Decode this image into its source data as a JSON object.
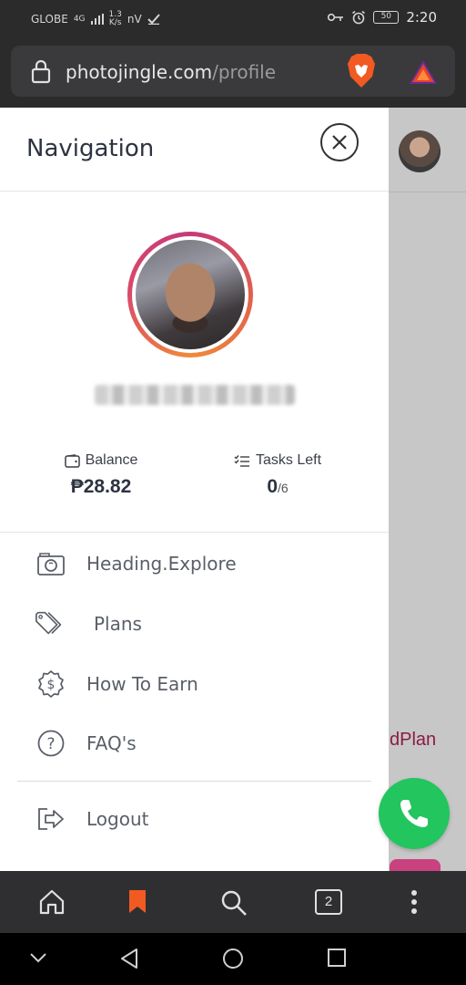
{
  "status_bar": {
    "carrier": "GLOBE",
    "network": "4G",
    "speed": "1.3",
    "speed_unit": "K/s",
    "extra": "nV",
    "battery": "50",
    "time": "2:20"
  },
  "browser": {
    "url_domain": "photojingle.com",
    "url_path": "/profile",
    "tab_count": "2"
  },
  "drawer": {
    "title": "Navigation",
    "balance_label": "Balance",
    "balance_value": "₱28.82",
    "tasks_label": "Tasks Left",
    "tasks_done": "0",
    "tasks_total": "/6",
    "menu": [
      {
        "label": "Heading.Explore",
        "icon": "camera-icon"
      },
      {
        "label": "Plans",
        "icon": "tags-icon"
      },
      {
        "label": "How To Earn",
        "icon": "dollar-badge-icon"
      },
      {
        "label": "FAQ's",
        "icon": "question-icon"
      },
      {
        "label": "Logout",
        "icon": "logout-icon"
      }
    ]
  },
  "background_page": {
    "partial_text": "dPlan"
  },
  "colors": {
    "accent_pink": "#c53a78",
    "whatsapp_green": "#22c55e",
    "plan_text": "#8b1a45"
  }
}
